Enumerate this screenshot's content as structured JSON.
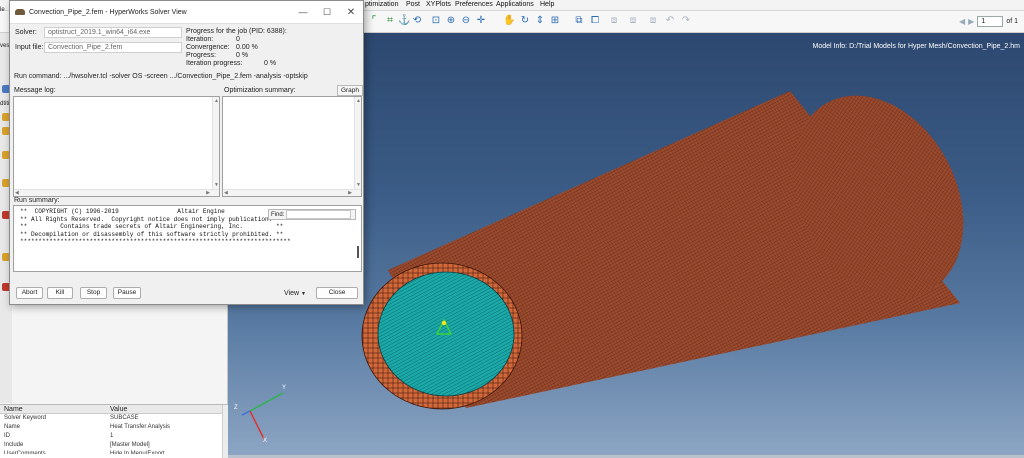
{
  "app": {
    "menu": [
      "ptimization",
      "Post",
      "XYPlots",
      "Preferences",
      "Applications",
      "Help"
    ],
    "page_nav": {
      "page": "1",
      "of": "of 1"
    },
    "model_info": "Model Info: D:/Trial Models for Hyper Mesh/Convection_Pipe_2.hm",
    "triad": {
      "x": "X",
      "y": "Y",
      "z": "Z"
    },
    "sidebar_fragments": [
      "le",
      "vessi",
      "dtiti"
    ],
    "properties": {
      "headers": [
        "Name",
        "Value"
      ],
      "rows": [
        [
          "Solver Keyword",
          "SUBCASE"
        ],
        [
          "Name",
          "Heat Transfer Analysis"
        ],
        [
          "ID",
          "1"
        ],
        [
          "Include",
          "[Master Model]"
        ],
        [
          "UserComments",
          "Hide In Menu/Export"
        ]
      ]
    }
  },
  "dialog": {
    "title": "Convection_Pipe_2.fem - HyperWorks Solver View",
    "solver_label": "Solver:",
    "solver_value": "optistruct_2019.1_win64_i64.exe",
    "input_label": "Input file:",
    "input_value": "Convection_Pipe_2.fem",
    "progress_title": "Progress for the job (PID: 6388):",
    "progress": [
      {
        "label": "Iteration:",
        "value": "0"
      },
      {
        "label": "Convergence:",
        "value": "0.00 %"
      },
      {
        "label": "Progress:",
        "value": "0 %"
      },
      {
        "label": "Iteration progress:",
        "value": "0 %"
      }
    ],
    "run_command": "Run command: .../hwsolver.tcl -solver OS -screen .../Convection_Pipe_2.fem -analysis -optskip",
    "message_log_label": "Message log:",
    "optimization_label": "Optimization summary:",
    "graph_button": "Graph",
    "run_summary_label": "Run summary:",
    "find_label": "Find:",
    "run_summary_lines": [
      "**  COPYRIGHT (C) 1996-2019                Altair Engine",
      "** All Rights Reserved.  Copyright notice does not imply publication. **",
      "**         Contains trade secrets of Altair Engineering, Inc.         **",
      "** Decompilation or disassembly of this software strictly prohibited. **",
      "**************************************************************************"
    ],
    "buttons": {
      "abort": "Abort",
      "kill": "Kill",
      "stop": "Stop",
      "pause": "Pause",
      "view": "View",
      "close": "Close"
    }
  }
}
